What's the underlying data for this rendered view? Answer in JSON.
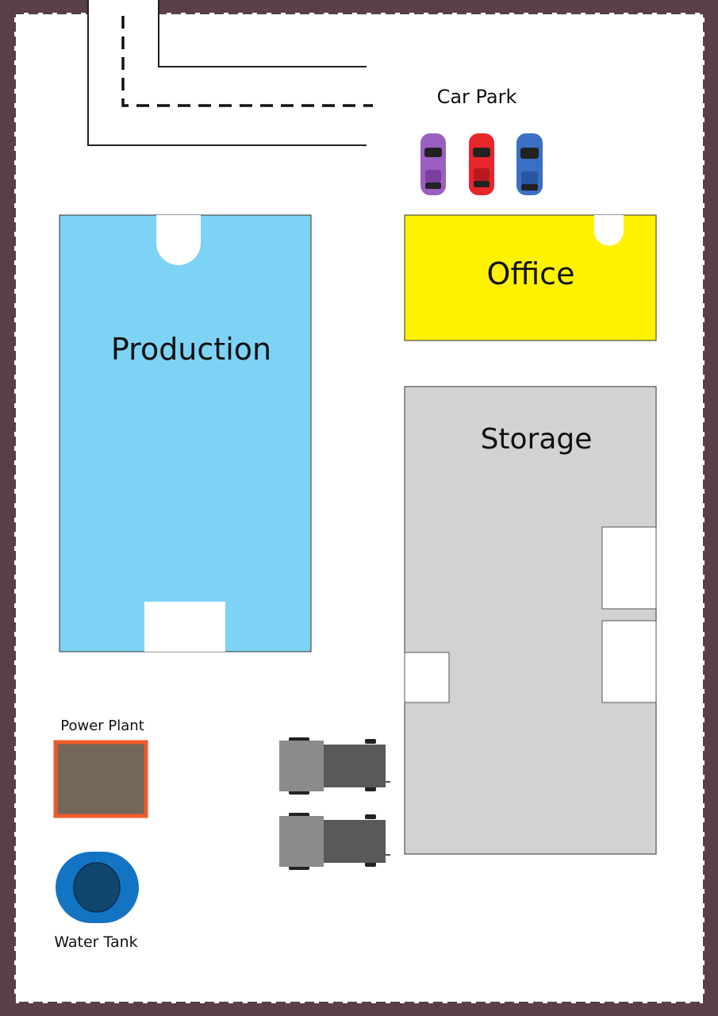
{
  "labels": {
    "car_park": "Car Park",
    "office": "Office",
    "production": "Production",
    "storage": "Storage",
    "power_plant": "Power Plant",
    "water_tank": "Water Tank"
  },
  "colors": {
    "frame": "#5a3f47",
    "ground": "#ffffff",
    "production": "#7dd3f5",
    "office": "#fff200",
    "storage": "#d1d2d4",
    "power_plant_fill": "#736759",
    "power_plant_border": "#ef5a2a",
    "water_tank_outer": "#1474c4",
    "water_tank_inner": "#11466e",
    "truck_cab": "#8a8b8d",
    "truck_trailer": "#58595b",
    "car_purple": "#9b5fc0",
    "car_red": "#e8262c",
    "car_blue": "#3b6fc4"
  },
  "icons": [
    "car-icon",
    "truck-icon"
  ]
}
